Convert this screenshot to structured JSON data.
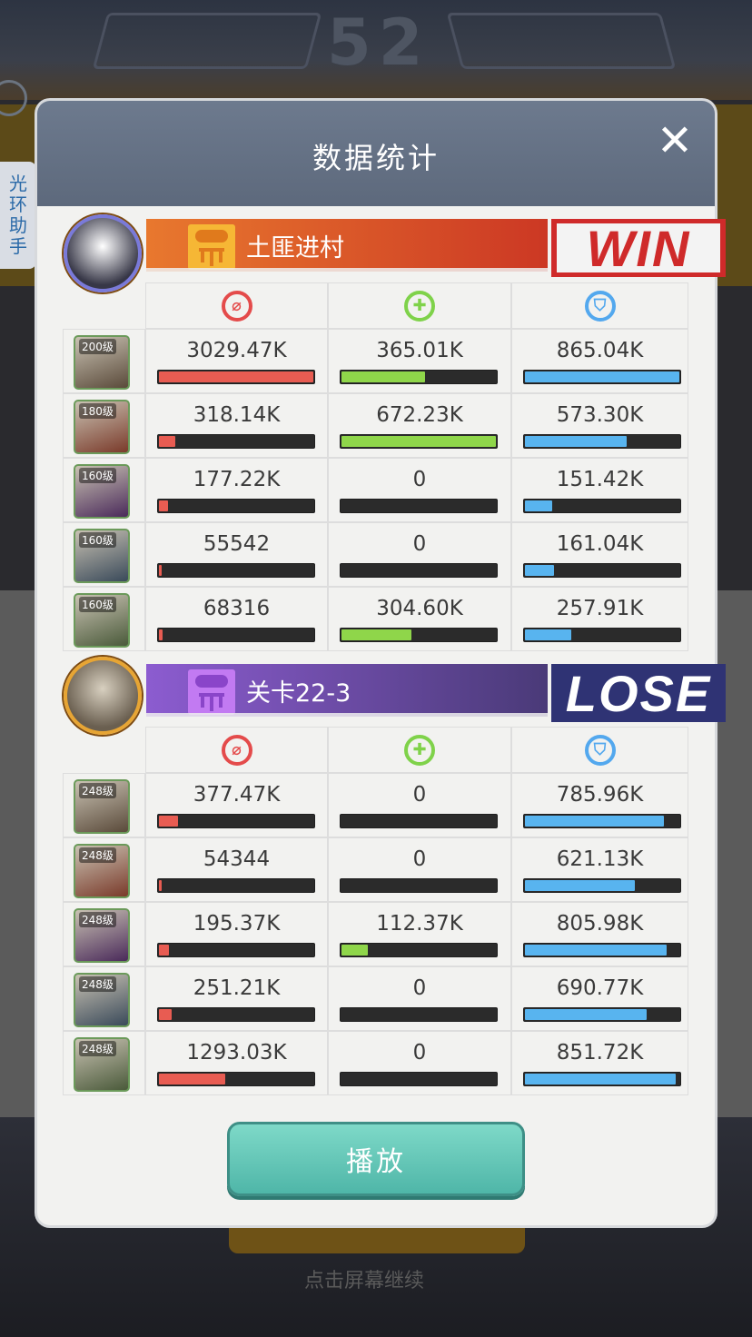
{
  "background": {
    "score": "52",
    "bottom_text": "点击屏幕继续"
  },
  "side_helper": {
    "label_chars": [
      "光",
      "环",
      "助",
      "手"
    ]
  },
  "panel": {
    "title": "数据统计",
    "close_icon": "close-icon"
  },
  "team1": {
    "name": "土匪进村",
    "result": "WIN",
    "color": "#cf2a2a",
    "rows": [
      {
        "level": "200级",
        "damage": "3029.47K",
        "damage_pct": 100,
        "heal": "365.01K",
        "heal_pct": 54,
        "defense": "865.04K",
        "defense_pct": 100
      },
      {
        "level": "180级",
        "damage": "318.14K",
        "damage_pct": 10.5,
        "heal": "672.23K",
        "heal_pct": 100,
        "defense": "573.30K",
        "defense_pct": 66
      },
      {
        "level": "160级",
        "damage": "177.22K",
        "damage_pct": 5.8,
        "heal": "0",
        "heal_pct": 0,
        "defense": "151.42K",
        "defense_pct": 17.5
      },
      {
        "level": "160级",
        "damage": "55542",
        "damage_pct": 1.8,
        "heal": "0",
        "heal_pct": 0,
        "defense": "161.04K",
        "defense_pct": 18.6
      },
      {
        "level": "160级",
        "damage": "68316",
        "damage_pct": 2.3,
        "heal": "304.60K",
        "heal_pct": 45,
        "defense": "257.91K",
        "defense_pct": 29.8
      }
    ]
  },
  "team2": {
    "name": "关卡22-3",
    "result": "LOSE",
    "color": "#2f3374",
    "rows": [
      {
        "level": "248级",
        "damage": "377.47K",
        "damage_pct": 12.5,
        "heal": "0",
        "heal_pct": 0,
        "defense": "785.96K",
        "defense_pct": 90
      },
      {
        "level": "248级",
        "damage": "54344",
        "damage_pct": 1.8,
        "heal": "0",
        "heal_pct": 0,
        "defense": "621.13K",
        "defense_pct": 71
      },
      {
        "level": "248级",
        "damage": "195.37K",
        "damage_pct": 6.5,
        "heal": "112.37K",
        "heal_pct": 17,
        "defense": "805.98K",
        "defense_pct": 92
      },
      {
        "level": "248级",
        "damage": "251.21K",
        "damage_pct": 8.3,
        "heal": "0",
        "heal_pct": 0,
        "defense": "690.77K",
        "defense_pct": 79
      },
      {
        "level": "248级",
        "damage": "1293.03K",
        "damage_pct": 42.7,
        "heal": "0",
        "heal_pct": 0,
        "defense": "851.72K",
        "defense_pct": 97.5
      }
    ]
  },
  "icons": {
    "damage": "damage-icon",
    "heal": "heal-icon",
    "defense": "shield-icon"
  },
  "play_button": {
    "label": "播放"
  }
}
